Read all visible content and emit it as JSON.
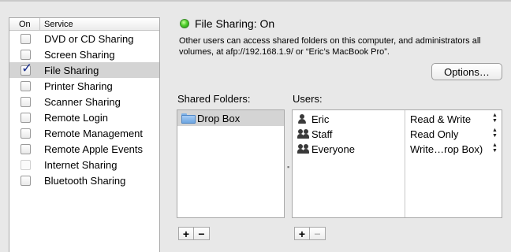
{
  "service_list": {
    "header_on": "On",
    "header_service": "Service",
    "items": [
      {
        "label": "DVD or CD Sharing",
        "checked": false,
        "enabled": true
      },
      {
        "label": "Screen Sharing",
        "checked": false,
        "enabled": true
      },
      {
        "label": "File Sharing",
        "checked": true,
        "enabled": true,
        "selected": true
      },
      {
        "label": "Printer Sharing",
        "checked": false,
        "enabled": true
      },
      {
        "label": "Scanner Sharing",
        "checked": false,
        "enabled": true
      },
      {
        "label": "Remote Login",
        "checked": false,
        "enabled": true
      },
      {
        "label": "Remote Management",
        "checked": false,
        "enabled": true
      },
      {
        "label": "Remote Apple Events",
        "checked": false,
        "enabled": true
      },
      {
        "label": "Internet Sharing",
        "checked": false,
        "enabled": false
      },
      {
        "label": "Bluetooth Sharing",
        "checked": false,
        "enabled": true
      }
    ]
  },
  "status": {
    "title": "File Sharing: On",
    "indicator_color": "#4fcf2c",
    "description": "Other users can access shared folders on this computer, and administrators all volumes, at afp://192.168.1.9/ or “Eric’s MacBook Pro”."
  },
  "options_button": "Options…",
  "shared_folders": {
    "label": "Shared Folders:",
    "items": [
      {
        "name": "Drop Box",
        "icon": "folder-icon"
      }
    ]
  },
  "users": {
    "label": "Users:",
    "items": [
      {
        "name": "Eric",
        "icon": "user-icon",
        "permission": "Read & Write"
      },
      {
        "name": "Staff",
        "icon": "group-icon",
        "permission": "Read Only"
      },
      {
        "name": "Everyone",
        "icon": "group-icon",
        "permission": "Write…rop Box)"
      }
    ]
  },
  "buttons": {
    "add": "+",
    "remove": "−"
  }
}
